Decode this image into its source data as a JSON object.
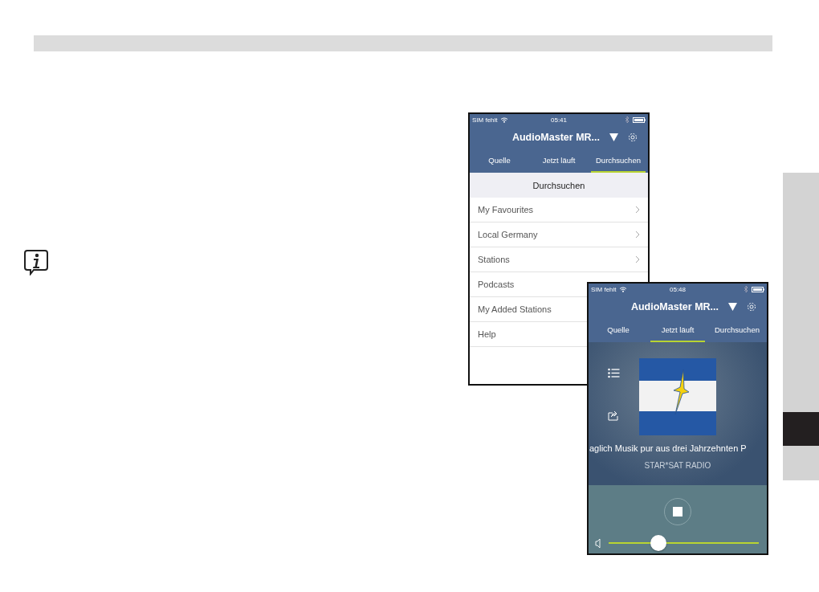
{
  "side_index": {
    "sections": [
      {
        "selected": false
      },
      {
        "selected": true
      },
      {
        "selected": false
      }
    ]
  },
  "phones": [
    {
      "kind": "browse",
      "status": {
        "carrier": "SIM fehlt",
        "time": "05:41"
      },
      "device": "AudioMaster MR...",
      "tabs": [
        {
          "label": "Quelle",
          "selected": false
        },
        {
          "label": "Jetzt läuft",
          "selected": false
        },
        {
          "label": "Durchsuchen",
          "selected": true
        }
      ],
      "heading": "Durchsuchen",
      "items": [
        {
          "label": "My Favourites",
          "chevron": true
        },
        {
          "label": "Local Germany",
          "chevron": true
        },
        {
          "label": "Stations",
          "chevron": true
        },
        {
          "label": "Podcasts"
        },
        {
          "label": "My Added Stations"
        },
        {
          "label": "Help"
        }
      ]
    },
    {
      "kind": "now_playing",
      "status": {
        "carrier": "SIM fehlt",
        "time": "05:48"
      },
      "device": "AudioMaster MR...",
      "tabs": [
        {
          "label": "Quelle",
          "selected": false
        },
        {
          "label": "Jetzt läuft",
          "selected": true
        },
        {
          "label": "Durchsuchen",
          "selected": false
        }
      ],
      "description": "aglich Musik pur aus drei Jahrzehnten P",
      "station": "STAR*SAT RADIO",
      "playing": true,
      "volume": {
        "level": 0.33
      }
    }
  ]
}
